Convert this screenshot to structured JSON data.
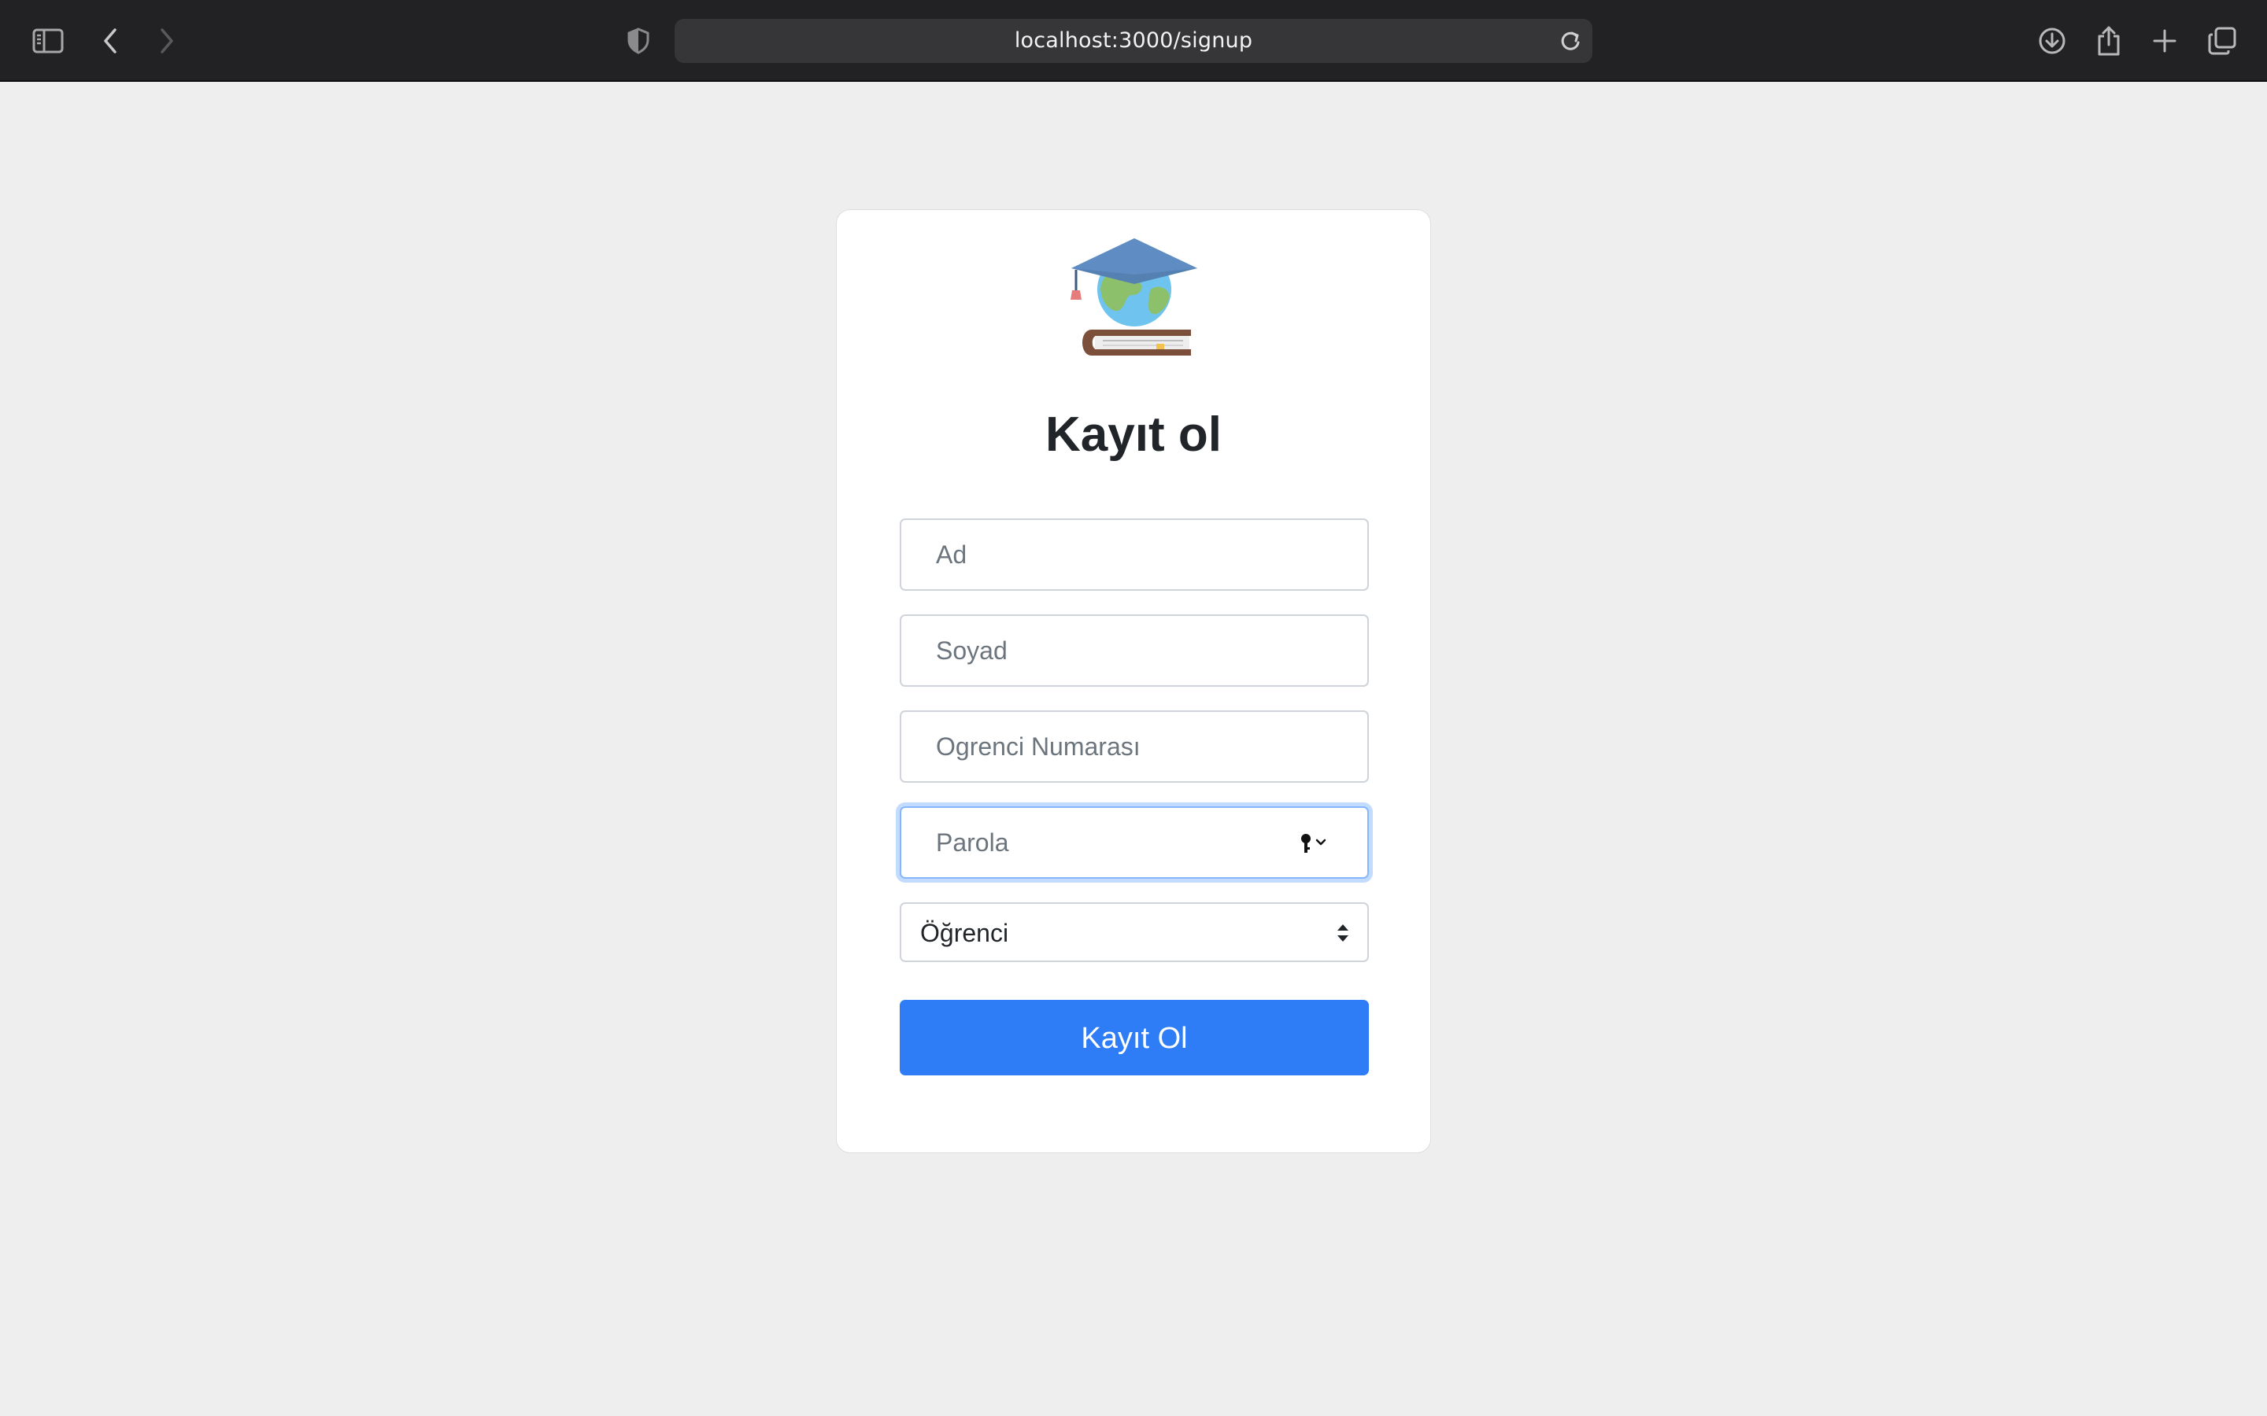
{
  "browser": {
    "url": "localhost:3000/signup"
  },
  "icons": {
    "sidebar": "sidebar-icon",
    "back": "chevron-left-icon",
    "forward": "chevron-right-icon",
    "privacy": "shield-icon",
    "reload": "reload-icon",
    "download": "download-icon",
    "share": "share-icon",
    "new_tab": "plus-icon",
    "tabs": "tab-overview-icon",
    "password_key": "key-icon"
  },
  "colors": {
    "page_background": "#eeeeee",
    "toolbar": "#222224",
    "primary_button": "#2e7cf6",
    "focus_ring": "#86b7fe"
  },
  "form": {
    "title": "Kayıt ol",
    "first_name": {
      "value": "",
      "placeholder": "Ad"
    },
    "last_name": {
      "value": "",
      "placeholder": "Soyad"
    },
    "student_number": {
      "value": "",
      "placeholder": "Ogrenci Numarası"
    },
    "password": {
      "value": "",
      "placeholder": "Parola"
    },
    "role_select": {
      "selected": "Öğrenci"
    },
    "submit_label": "Kayıt Ol"
  }
}
